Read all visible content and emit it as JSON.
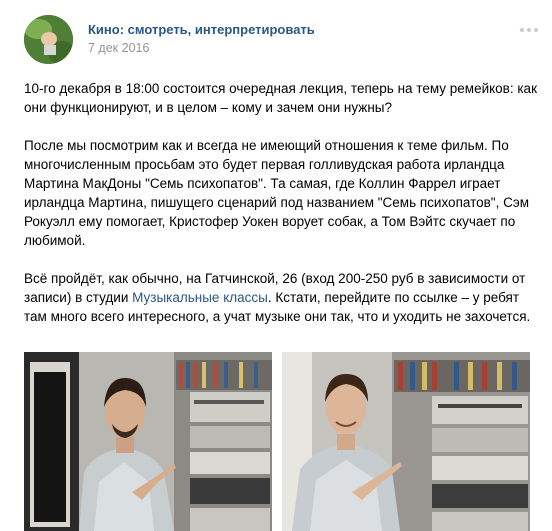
{
  "post": {
    "group_name": "Кино: смотреть, интерпретировать",
    "date": "7 дек 2016",
    "paragraph1": "10-го декабря в 18:00 состоится очередная лекция, теперь на тему ремейков: как они функционируют, и в целом – кому и зачем они нужны?",
    "paragraph2": "После мы посмотрим как и всегда не имеющий отношения к теме фильм. По многочисленным просьбам это будет первая голливудская работа ирландца Мартина МакДоны \"Семь психопатов\". Та самая, где Коллин Фаррел играет ирландца Мартина, пишущего сценарий под названием \"Семь психопатов\", Сэм Рокуэлл ему помогает, Кристофер Уокен ворует собак, а Том Вэйтс скучает по любимой.",
    "paragraph3_before_link": "Всё пройдёт, как обычно, на Гатчинской, 26 (вход 200-250 руб в зависимости от записи) в студии ",
    "paragraph3_link": "Музыкальные классы",
    "paragraph3_after_link": ". Кстати, перейдите по ссылке – у ребят там много всего интересного, а учат музыке они так, что и уходить не захочется."
  },
  "icons": {
    "more": "more-dots-icon"
  },
  "colors": {
    "link": "#2a5885",
    "date": "#939393",
    "text": "#000000"
  }
}
